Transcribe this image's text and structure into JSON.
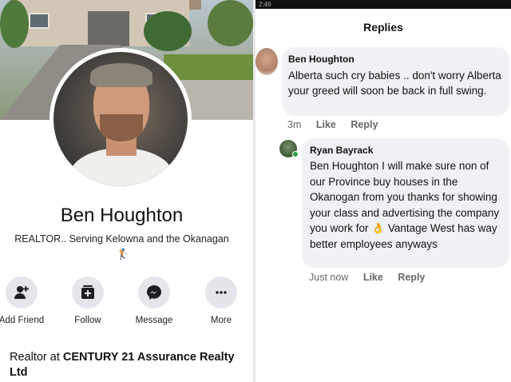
{
  "profile": {
    "name": "Ben Houghton",
    "bio": "REALTOR.. Serving Kelowna and the Okanagan",
    "bio_emoji": "🏌",
    "actions": [
      {
        "label": "Add Friend",
        "icon": "add-friend-icon"
      },
      {
        "label": "Follow",
        "icon": "follow-icon"
      },
      {
        "label": "Message",
        "icon": "messenger-icon"
      },
      {
        "label": "More",
        "icon": "more-icon"
      }
    ],
    "work_prefix": "Realtor at ",
    "work_company": "CENTURY 21 Assurance Realty Ltd"
  },
  "replies": {
    "status_text": "2:46",
    "header": "Replies",
    "comments": [
      {
        "author": "Ben Houghton",
        "text": "Alberta such cry babies .. don't worry Alberta your greed will soon be back in full swing.",
        "time": "3m",
        "like": "Like",
        "reply": "Reply"
      },
      {
        "author": "Ryan Bayrack",
        "text": "Ben Houghton I will make sure non of our Province buy houses in the Okanogan from you thanks for showing your class and advertising the company you work for 👌 Vantage West has way better employees anyways",
        "time": "Just now",
        "like": "Like",
        "reply": "Reply"
      }
    ]
  },
  "colors": {
    "bubble": "#eff1f4",
    "meta_text": "#65676b",
    "action_circle": "#e4e6eb",
    "online": "#31a24c"
  }
}
